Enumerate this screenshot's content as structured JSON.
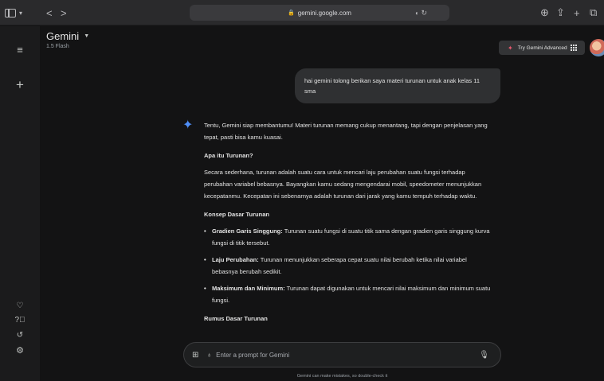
{
  "browser": {
    "url": "gemini.google.com",
    "nav_back": "<",
    "nav_forward": ">",
    "new_tab": "+"
  },
  "app": {
    "title": "Gemini",
    "model": "1.5 Flash",
    "try_advanced": "Try Gemini Advanced"
  },
  "conversation": {
    "user_message": "hai gemini tolong berikan saya materi turunan untuk anak kelas 11 sma",
    "response": {
      "intro": "Tentu, Gemini siap membantumu! Materi turunan memang cukup menantang, tapi dengan penjelasan yang tepat, pasti bisa kamu kuasai.",
      "h1": "Apa itu Turunan?",
      "p1": "Secara sederhana, turunan adalah suatu cara untuk mencari laju perubahan suatu fungsi terhadap perubahan variabel bebasnya. Bayangkan kamu sedang mengendarai mobil, speedometer menunjukkan kecepatanmu. Kecepatan ini sebenarnya adalah turunan dari jarak yang kamu tempuh terhadap waktu.",
      "h2": "Konsep Dasar Turunan",
      "bullets": [
        {
          "term": "Gradien Garis Singgung:",
          "text": " Turunan suatu fungsi di suatu titik sama dengan gradien garis singgung kurva fungsi di titik tersebut."
        },
        {
          "term": "Laju Perubahan:",
          "text": " Turunan menunjukkan seberapa cepat suatu nilai berubah ketika nilai variabel bebasnya berubah sedikit."
        },
        {
          "term": "Maksimum dan Minimum:",
          "text": " Turunan dapat digunakan untuk mencari nilai maksimum dan minimum suatu fungsi."
        }
      ],
      "h3": "Rumus Dasar Turunan"
    }
  },
  "prompt": {
    "placeholder": "Enter a prompt for Gemini"
  },
  "footer": {
    "disclaimer": "Gemini can make mistakes, so double-check it"
  },
  "colors": {
    "background": "#131314",
    "sidebar": "#1b1b1c",
    "bubble": "#2f3032",
    "gemini_accent": "#4f8ef7",
    "advanced_accent": "#e8596f"
  }
}
